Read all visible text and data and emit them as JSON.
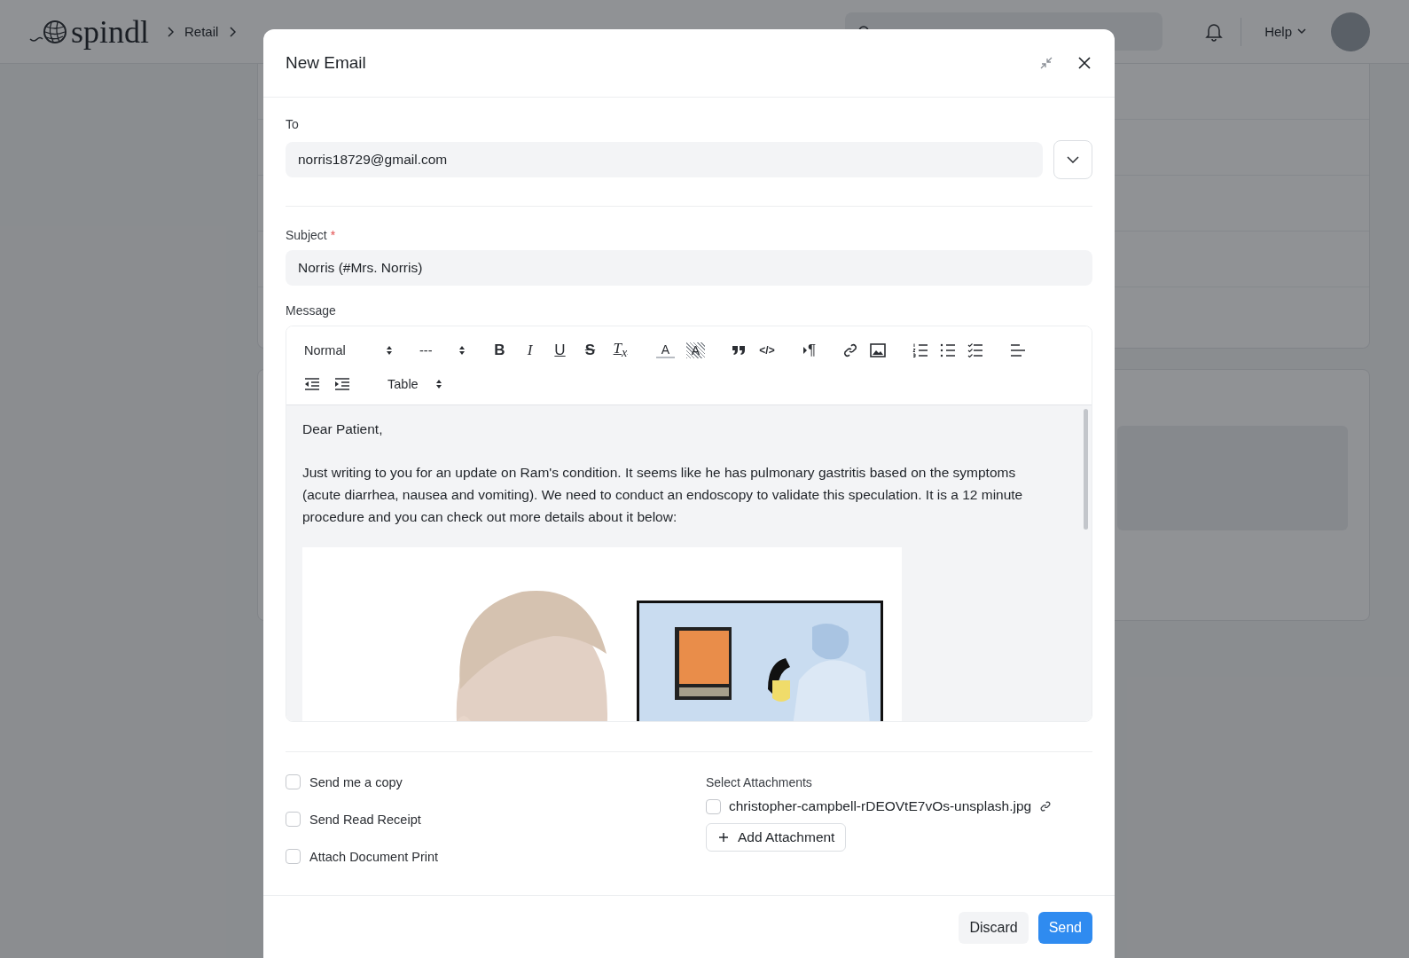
{
  "header": {
    "logo": "spindl",
    "breadcrumbs": [
      "Retail"
    ],
    "help": "Help"
  },
  "dialog": {
    "title": "New Email",
    "to": {
      "label": "To",
      "value": "norris18729@gmail.com"
    },
    "subject": {
      "label": "Subject",
      "required": true,
      "required_mark": "*",
      "value": "Norris (#Mrs. Norris)"
    },
    "message": {
      "label": "Message",
      "toolbar": {
        "format": "Normal",
        "heading": "---",
        "marks": [
          "B",
          "I",
          "U",
          "S",
          "T$_{x}$"
        ],
        "colors": [
          "A",
          "A"
        ],
        "code": "</>",
        "direction": "¶",
        "table": "Table"
      },
      "paragraphs": [
        "Dear Patient,",
        "Just writing to you for an update on Ram's condition. It seems like he has pulmonary gastritis based on the symptoms (acute diarrhea, nausea and vomiting). We need to conduct an endoscopy to validate this speculation. It is a 12 minute procedure and you can check out more details about it below:"
      ],
      "image": {
        "kind": "picture"
      }
    },
    "options": [
      {
        "label": "Send me a copy",
        "checked": false
      },
      {
        "label": "Send Read Receipt",
        "checked": false
      },
      {
        "label": "Attach Document Print",
        "checked": false
      }
    ],
    "attachments": {
      "label": "Select Attachments",
      "files": [
        {
          "name": "christopher-campbell-rDEOVtE7vOs-unsplash.jpg",
          "checked": false
        }
      ],
      "add": "Add Attachment"
    },
    "buttons": {
      "discard": "Discard",
      "send": "Send"
    }
  }
}
